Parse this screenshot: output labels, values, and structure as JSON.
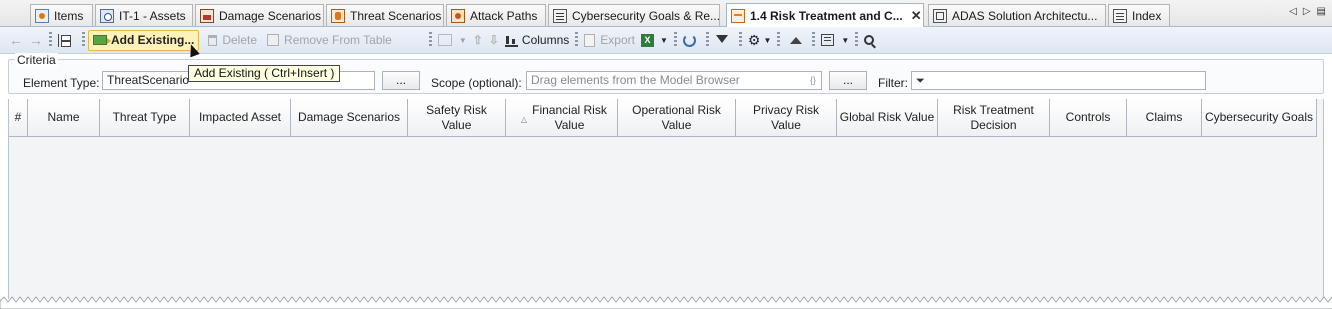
{
  "tabs": [
    {
      "label": "Items",
      "icon": "item-icon",
      "active": false
    },
    {
      "label": "IT-1 - Assets",
      "icon": "asset-icon",
      "active": false
    },
    {
      "label": "Damage Scenarios",
      "icon": "damage-icon",
      "active": false
    },
    {
      "label": "Threat Scenarios",
      "icon": "threat-icon",
      "active": false
    },
    {
      "label": "Attack Paths",
      "icon": "attack-icon",
      "active": false
    },
    {
      "label": "Cybersecurity Goals & Re...",
      "icon": "goals-table-icon",
      "active": false
    },
    {
      "label": "1.4 Risk Treatment and C...",
      "icon": "risk-table-icon",
      "active": true
    },
    {
      "label": "ADAS Solution Architectu...",
      "icon": "diagram-icon",
      "active": false
    },
    {
      "label": "Index",
      "icon": "index-icon",
      "active": false
    }
  ],
  "tab_nav": {
    "prev": "◁",
    "next": "▷",
    "menu": "▤"
  },
  "toolbar": {
    "add_existing": "Add Existing...",
    "delete": "Delete",
    "remove_from_table": "Remove From Table",
    "columns": "Columns",
    "export": "Export"
  },
  "tooltip": "Add Existing ( Ctrl+Insert )",
  "criteria": {
    "title": "Criteria",
    "element_type_label": "Element Type:",
    "element_type_value": "ThreatScenario",
    "browse_label": "...",
    "scope_label": "Scope (optional):",
    "scope_placeholder": "Drag elements from the Model Browser",
    "filter_label": "Filter:"
  },
  "table": {
    "columns": [
      "#",
      "Name",
      "Threat Type",
      "Impacted Asset",
      "Damage Scenarios",
      "Safety Risk Value",
      "Financial Risk Value",
      "Operational Risk Value",
      "Privacy Risk Value",
      "Global Risk Value",
      "Risk Treatment Decision",
      "Controls",
      "Claims",
      "Cybersecurity Goals"
    ],
    "sorted_column": "Financial Risk Value",
    "rows": []
  },
  "colors": {
    "accent": "#fff2b8",
    "header_bg": "#dde6f2",
    "active_tab": "#ffffff"
  }
}
